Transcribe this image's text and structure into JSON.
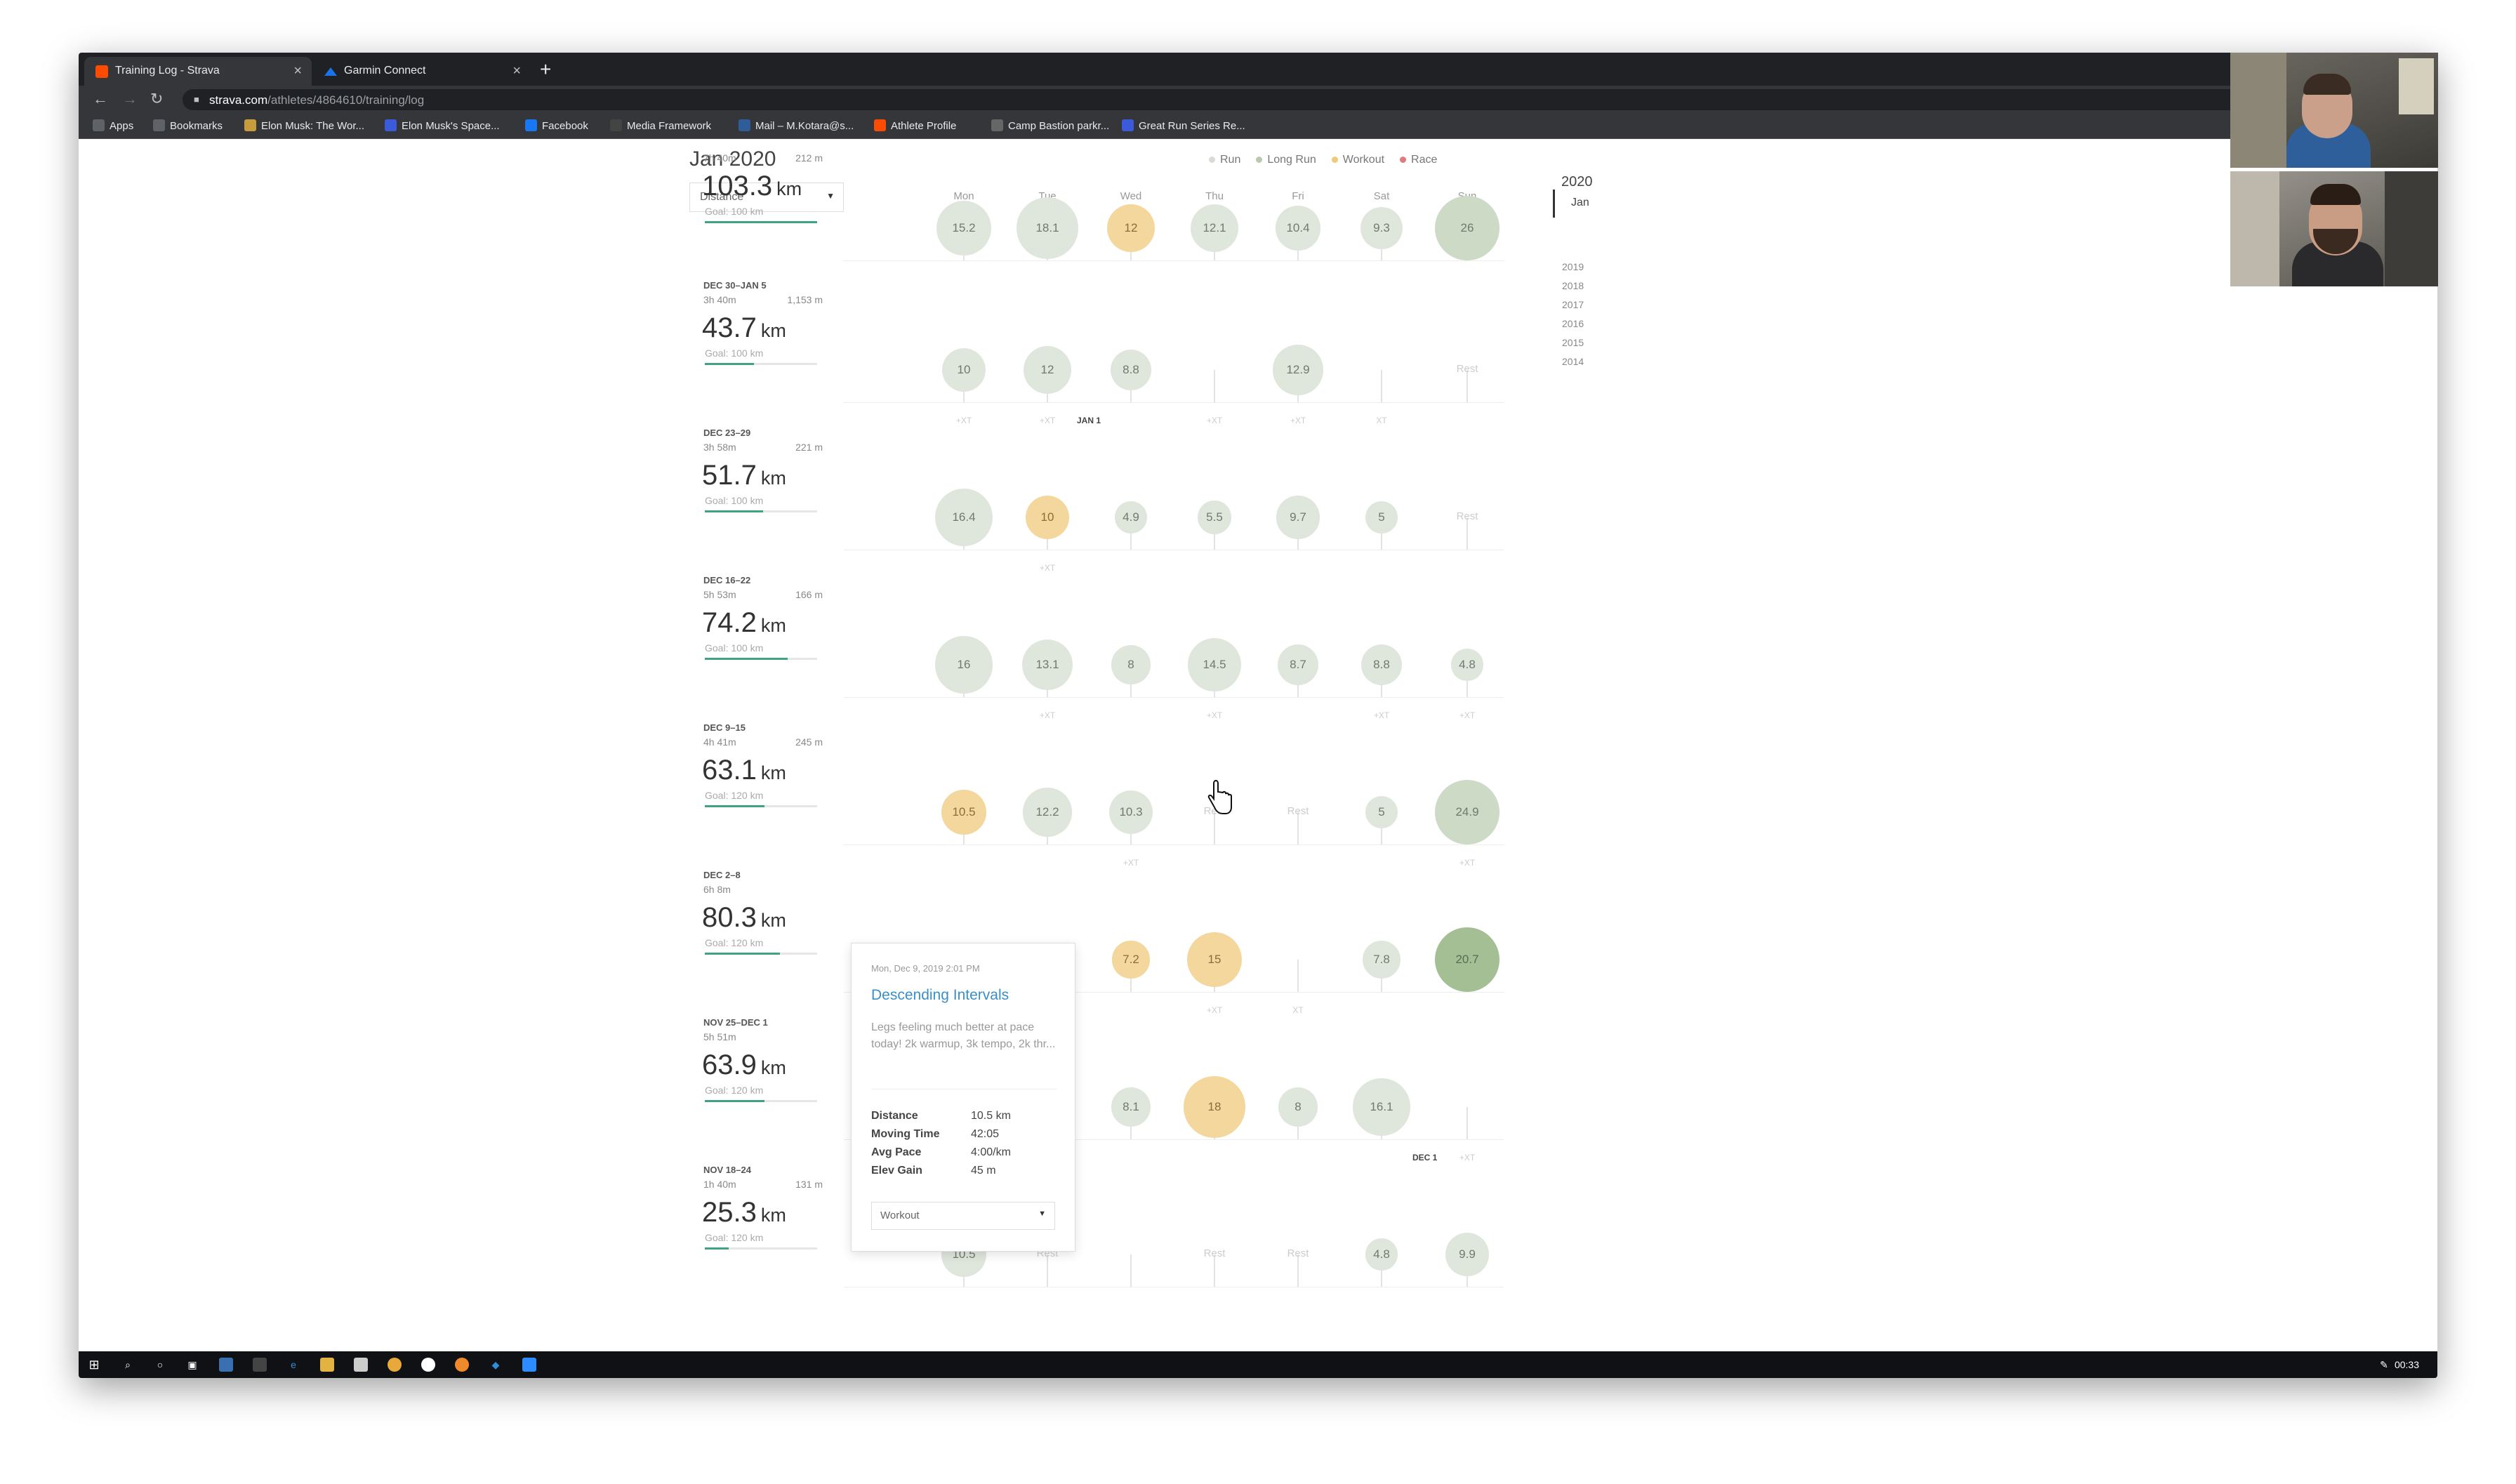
{
  "browser": {
    "tabs": [
      {
        "label": "Training Log - Strava",
        "active": true,
        "favicon_color": "#fc4c02"
      },
      {
        "label": "Garmin Connect",
        "active": false,
        "favicon_color": "#1a73e8"
      }
    ],
    "close_glyph": "×",
    "new_tab_glyph": "+",
    "url_host": "strava.com",
    "url_path": "/athletes/4864610/training/log",
    "bookmarks": [
      {
        "label": "Apps",
        "icon": "apps-icon",
        "color": "#5f6368"
      },
      {
        "label": "Bookmarks",
        "icon": "star-icon",
        "color": "#5f6368"
      },
      {
        "label": "Elon Musk: The Wor...",
        "icon": "video-icon",
        "color": "#c89b3c"
      },
      {
        "label": "Elon Musk's Space...",
        "icon": "bookmark-icon",
        "color": "#3b5bdb"
      },
      {
        "label": "Facebook",
        "icon": "facebook-icon",
        "color": "#1877f2"
      },
      {
        "label": "Media Framework",
        "icon": "mf-icon",
        "color": "#444"
      },
      {
        "label": "Mail – M.Kotara@s...",
        "icon": "mail-icon",
        "color": "#2f5d9a"
      },
      {
        "label": "Athlete Profile",
        "icon": "strava-icon",
        "color": "#fc4c02"
      },
      {
        "label": "Camp Bastion parkr...",
        "icon": "globe-icon",
        "color": "#666"
      },
      {
        "label": "Great Run Series Re...",
        "icon": "run-icon",
        "color": "#3b5bdb"
      }
    ]
  },
  "log": {
    "title": "Jan 2020",
    "legend": [
      {
        "label": "Run",
        "color": "#d7dcd5"
      },
      {
        "label": "Long Run",
        "color": "#b9c8b1"
      },
      {
        "label": "Workout",
        "color": "#f1c978"
      },
      {
        "label": "Race",
        "color": "#e27a7a"
      }
    ],
    "metric_select": "Distance",
    "days": [
      "Mon",
      "Tue",
      "Wed",
      "Thu",
      "Fri",
      "Sat",
      "Sun"
    ],
    "weeks": [
      {
        "date": "",
        "time": "7h 40m",
        "elev": "212 m",
        "distance": "103.3",
        "unit": "km",
        "goal": "Goal: 100 km",
        "goal_fraction": 1.0,
        "bubbles": [
          "15.2",
          "18.1",
          "12",
          "12.1",
          "10.4",
          "9.3",
          "26"
        ],
        "types": [
          "run",
          "run",
          "workout",
          "run",
          "run",
          "run",
          "long"
        ],
        "xt": [
          "",
          "",
          "",
          "",
          "",
          "",
          ""
        ]
      },
      {
        "date": "DEC 30–JAN 5",
        "time": "3h 40m",
        "elev": "1,153 m",
        "distance": "43.7",
        "unit": "km",
        "goal": "Goal: 100 km",
        "goal_fraction": 0.44,
        "bubbles": [
          "10",
          "12",
          "8.8",
          "",
          "12.9",
          "",
          "Rest"
        ],
        "types": [
          "run",
          "run",
          "run",
          "none",
          "run",
          "none",
          "rest"
        ],
        "xt": [
          "+XT",
          "+XT",
          "",
          "+XT",
          "+XT",
          "XT",
          ""
        ],
        "marker": "JAN 1"
      },
      {
        "date": "DEC 23–29",
        "time": "3h 58m",
        "elev": "221 m",
        "distance": "51.7",
        "unit": "km",
        "goal": "Goal: 100 km",
        "goal_fraction": 0.52,
        "bubbles": [
          "16.4",
          "10",
          "4.9",
          "5.5",
          "9.7",
          "5",
          "Rest"
        ],
        "types": [
          "run",
          "workout",
          "run",
          "run",
          "run",
          "run",
          "rest"
        ],
        "xt": [
          "",
          "+XT",
          "",
          "",
          "",
          "",
          ""
        ]
      },
      {
        "date": "DEC 16–22",
        "time": "5h 53m",
        "elev": "166 m",
        "distance": "74.2",
        "unit": "km",
        "goal": "Goal: 100 km",
        "goal_fraction": 0.74,
        "bubbles": [
          "16",
          "13.1",
          "8",
          "14.5",
          "8.7",
          "8.8",
          "4.8"
        ],
        "types": [
          "run",
          "run",
          "run",
          "run",
          "run",
          "run",
          "run"
        ],
        "xt": [
          "",
          "+XT",
          "",
          "+XT",
          "",
          "+XT",
          "+XT"
        ]
      },
      {
        "date": "DEC 9–15",
        "time": "4h 41m",
        "elev": "245 m",
        "distance": "63.1",
        "unit": "km",
        "goal": "Goal: 120 km",
        "goal_fraction": 0.53,
        "bubbles": [
          "10.5",
          "12.2",
          "10.3",
          "Rest",
          "Rest",
          "5",
          "24.9"
        ],
        "types": [
          "workout",
          "run",
          "run",
          "rest",
          "rest",
          "run",
          "long"
        ],
        "xt": [
          "",
          "",
          "+XT",
          "",
          "",
          "",
          "+XT"
        ]
      },
      {
        "date": "DEC 2–8",
        "time": "6h 8m",
        "elev": "",
        "distance": "80.3",
        "unit": "km",
        "goal": "Goal: 120 km",
        "goal_fraction": 0.67,
        "bubbles": [
          "",
          "",
          "7.2",
          "15",
          "",
          "7.8",
          "20.7"
        ],
        "types": [
          "none",
          "none",
          "workout",
          "workout",
          "none",
          "run",
          "dark"
        ],
        "xt": [
          "",
          "",
          "",
          "+XT",
          "XT",
          "",
          ""
        ]
      },
      {
        "date": "NOV 25–DEC 1",
        "time": "5h 51m",
        "elev": "",
        "distance": "63.9",
        "unit": "km",
        "goal": "Goal: 120 km",
        "goal_fraction": 0.53,
        "bubbles": [
          "",
          "",
          "8.1",
          "18",
          "8",
          "16.1",
          ""
        ],
        "types": [
          "none",
          "none",
          "run",
          "workout",
          "run",
          "run",
          "none"
        ],
        "xt": [
          "",
          "+XT",
          "",
          "",
          "",
          "",
          "+XT"
        ],
        "marker": "DEC 1"
      },
      {
        "date": "NOV 18–24",
        "time": "1h 40m",
        "elev": "131 m",
        "distance": "25.3",
        "unit": "km",
        "goal": "Goal: 120 km",
        "goal_fraction": 0.21,
        "bubbles": [
          "10.5",
          "Rest",
          "",
          "Rest",
          "Rest",
          "4.8",
          "9.9"
        ],
        "types": [
          "run",
          "rest",
          "none",
          "rest",
          "rest",
          "run",
          "run"
        ],
        "xt": [
          "",
          "",
          "",
          "",
          "",
          "",
          ""
        ]
      }
    ]
  },
  "years": {
    "current": "2020",
    "current_month": "Jan",
    "list": [
      "2019",
      "2018",
      "2017",
      "2016",
      "2015",
      "2014"
    ]
  },
  "popup": {
    "date": "Mon, Dec 9, 2019 2:01 PM",
    "title": "Descending Intervals",
    "description": "Legs feeling much better at pace today! 2k warmup, 3k tempo, 2k thr...",
    "stats": [
      {
        "label": "Distance",
        "value": "10.5 km"
      },
      {
        "label": "Moving Time",
        "value": "42:05"
      },
      {
        "label": "Avg Pace",
        "value": "4:00/km"
      },
      {
        "label": "Elev Gain",
        "value": "45 m"
      }
    ],
    "type_select": "Workout"
  },
  "taskbar": {
    "clock": "00:33"
  }
}
